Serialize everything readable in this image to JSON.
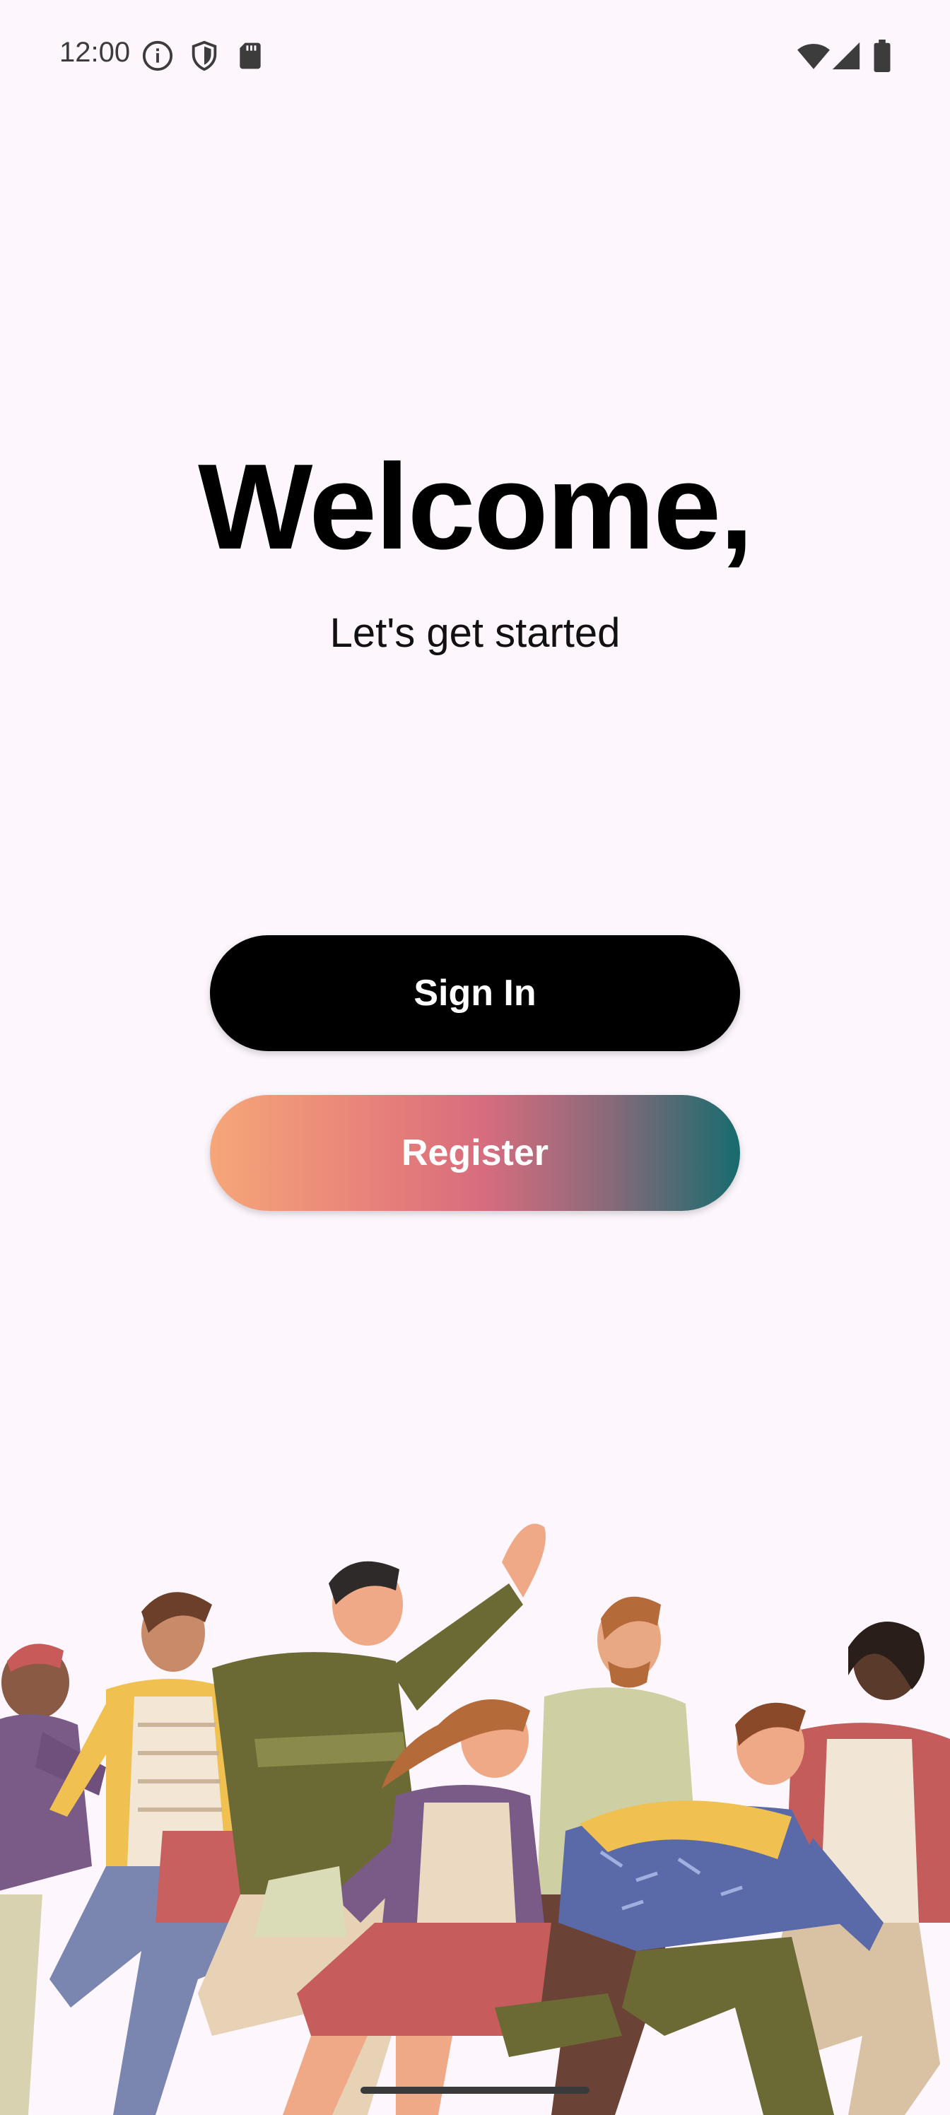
{
  "status_bar": {
    "time": "12:00",
    "left_icons": [
      "info-icon",
      "shield-icon",
      "sd-card-icon"
    ],
    "right_icons": [
      "wifi-icon",
      "cell-signal-icon",
      "battery-icon"
    ]
  },
  "welcome": {
    "title": "Welcome,",
    "subtitle": "Let's get started"
  },
  "buttons": {
    "sign_in": "Sign In",
    "register": "Register"
  },
  "colors": {
    "background": "#fdf7fd",
    "sign_in_bg": "#000000",
    "register_gradient": [
      "#f6a679",
      "#d66c7e",
      "#176b6e"
    ]
  },
  "illustration": {
    "icon": "crowd-of-people-running-illustration"
  }
}
